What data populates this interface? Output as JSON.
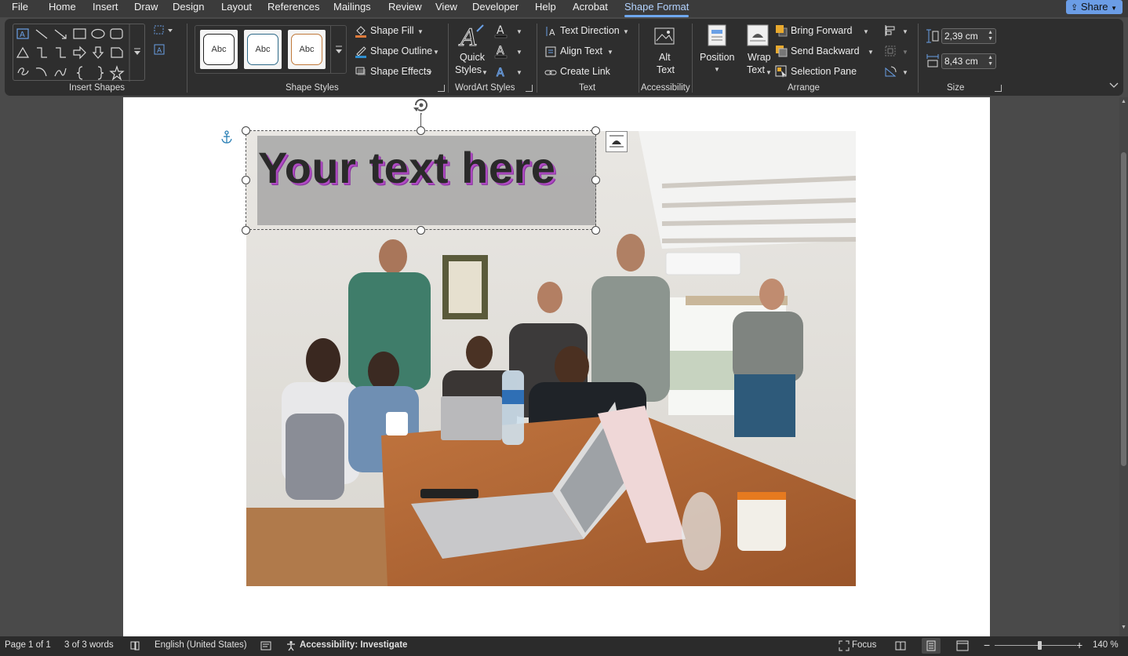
{
  "menu": {
    "items": [
      "File",
      "Home",
      "Insert",
      "Draw",
      "Design",
      "Layout",
      "References",
      "Mailings",
      "Review",
      "View",
      "Developer",
      "Help",
      "Acrobat",
      "Shape Format"
    ],
    "active": "Shape Format",
    "share_label": "Share"
  },
  "ribbon": {
    "insert_shapes": {
      "label": "Insert Shapes"
    },
    "shape_styles": {
      "label": "Shape Styles",
      "gallery": [
        "Abc",
        "Abc",
        "Abc"
      ],
      "gallery_border_colors": [
        "#222222",
        "#2f6b8a",
        "#c0793a"
      ],
      "shape_fill": "Shape Fill",
      "shape_outline": "Shape Outline",
      "shape_effects": "Shape Effects"
    },
    "wordart": {
      "label": "WordArt Styles",
      "quick_styles_line1": "Quick",
      "quick_styles_line2": "Styles"
    },
    "text": {
      "label": "Text",
      "text_direction": "Text Direction",
      "align_text": "Align Text",
      "create_link": "Create Link"
    },
    "accessibility": {
      "label": "Accessibility",
      "alt_text_line1": "Alt",
      "alt_text_line2": "Text"
    },
    "arrange": {
      "label": "Arrange",
      "position": "Position",
      "wrap_line1": "Wrap",
      "wrap_line2": "Text",
      "bring_forward": "Bring Forward",
      "send_backward": "Send Backward",
      "selection_pane": "Selection Pane"
    },
    "size": {
      "label": "Size",
      "height": "2,39 cm",
      "width": "8,43 cm"
    }
  },
  "document": {
    "wordart_text": "Your text here",
    "wordart_shadow_color": "#b04cc4"
  },
  "status": {
    "page": "Page 1 of 1",
    "words": "3 of 3 words",
    "language": "English (United States)",
    "accessibility": "Accessibility: Investigate",
    "focus": "Focus",
    "zoom": "140 %",
    "zoom_level": 0.55
  },
  "colors": {
    "accent": "#6fa8ef",
    "ribbon_bg": "#2e2e2e",
    "menubar_bg": "#3b3b3b",
    "share_bg": "#6b9de6"
  }
}
